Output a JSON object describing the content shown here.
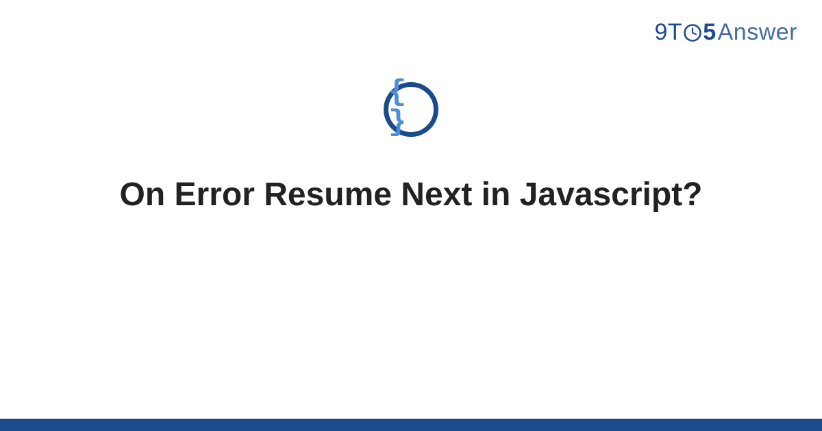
{
  "brand": {
    "part1": "9T",
    "part2": "5",
    "part3": "Answer"
  },
  "badge": {
    "glyph": "{ }"
  },
  "title": "On Error Resume Next in Javascript?",
  "colors": {
    "brand_dark": "#1a4b8c",
    "brand_light": "#4a8dd8"
  }
}
